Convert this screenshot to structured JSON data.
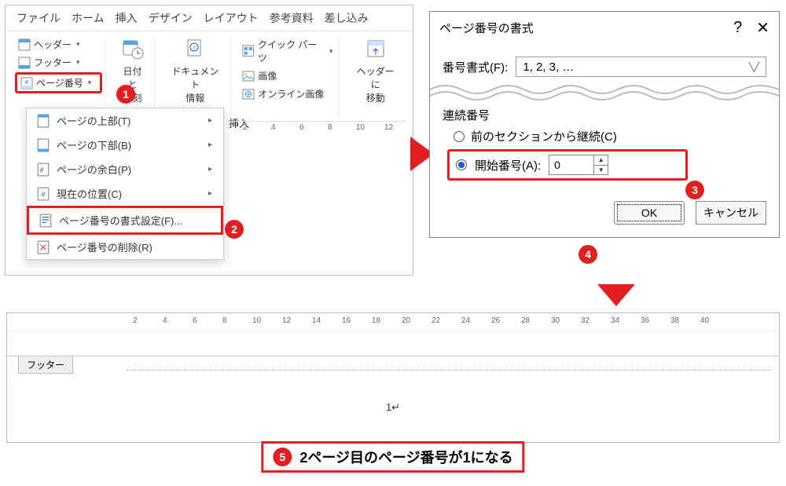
{
  "tabs": [
    "ファイル",
    "ホーム",
    "挿入",
    "デザイン",
    "レイアウト",
    "参考資料",
    "差し込み"
  ],
  "ribbon": {
    "header": "ヘッダー",
    "footer": "フッター",
    "page_number": "ページ番号",
    "datetime": "日付と\n時刻",
    "docinfo": "ドキュメント\n情報",
    "quickparts": "クイック パーツ",
    "image": "画像",
    "online_image": "オンライン画像",
    "goto_header": "ヘッダーに\n移動",
    "insert_group": "挿入"
  },
  "page_number_menu": {
    "top": "ページの上部(T)",
    "bottom": "ページの下部(B)",
    "margin": "ページの余白(P)",
    "current": "現在の位置(C)",
    "format": "ページ番号の書式設定(F)...",
    "remove": "ページ番号の削除(R)"
  },
  "ruler1": [
    "2",
    "4",
    "6",
    "8",
    "10",
    "12"
  ],
  "dialog": {
    "title": "ページ番号の書式",
    "help": "?",
    "format_label": "番号書式(F):",
    "format_value": "1, 2, 3, …",
    "seq_title": "連続番号",
    "continue": "前のセクションから継続(C)",
    "start_at": "開始番号(A):",
    "start_value": "0",
    "ok": "OK",
    "cancel": "キャンセル"
  },
  "ruler2": [
    "2",
    "4",
    "6",
    "8",
    "10",
    "12",
    "14",
    "16",
    "18",
    "20",
    "22",
    "24",
    "26",
    "28",
    "30",
    "32",
    "34",
    "36",
    "38",
    "40"
  ],
  "footer_label": "フッター",
  "result_page_num": "1↵",
  "callout": "2ページ目のページ番号が1になる",
  "badges": {
    "b1": "1",
    "b2": "2",
    "b3": "3",
    "b4": "4",
    "b5": "5"
  }
}
